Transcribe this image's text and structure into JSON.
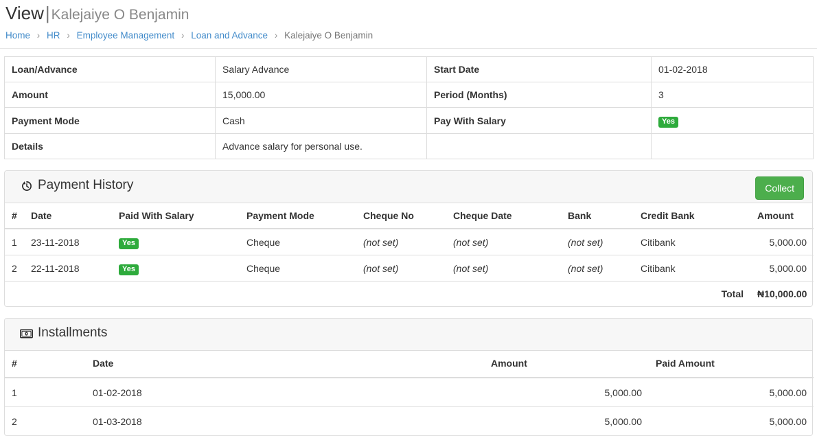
{
  "header": {
    "title_main": "View",
    "title_separator": "|",
    "subject": "Kalejaiye O Benjamin"
  },
  "breadcrumb": {
    "items": [
      {
        "label": "Home",
        "link": true
      },
      {
        "label": "HR",
        "link": true
      },
      {
        "label": "Employee Management",
        "link": true
      },
      {
        "label": "Loan and Advance",
        "link": true
      },
      {
        "label": "Kalejaiye O Benjamin",
        "link": false
      }
    ],
    "divider": "›"
  },
  "details": {
    "rows": [
      {
        "left_label": "Loan/Advance",
        "left_value": "Salary Advance",
        "right_label": "Start Date",
        "right_value": "01-02-2018",
        "right_is_badge": false
      },
      {
        "left_label": "Amount",
        "left_value": "15,000.00",
        "right_label": "Period (Months)",
        "right_value": "3",
        "right_is_badge": false
      },
      {
        "left_label": "Payment Mode",
        "left_value": "Cash",
        "right_label": "Pay With Salary",
        "right_value": "Yes",
        "right_is_badge": true
      },
      {
        "left_label": "Details",
        "left_value": "Advance salary for personal use.",
        "right_label": "",
        "right_value": "",
        "right_is_badge": false
      }
    ]
  },
  "payment_history": {
    "panel_title": "Payment History",
    "panel_icon": "history-icon",
    "collect_label": "Collect",
    "columns": [
      "#",
      "Date",
      "Paid With Salary",
      "Payment Mode",
      "Cheque No",
      "Cheque Date",
      "Bank",
      "Credit Bank",
      "Amount"
    ],
    "rows": [
      {
        "num": "1",
        "date": "23-11-2018",
        "paid_with_salary": "Yes",
        "payment_mode": "Cheque",
        "cheque_no": "(not set)",
        "cheque_date": "(not set)",
        "bank": "(not set)",
        "credit_bank": "Citibank",
        "amount": "5,000.00"
      },
      {
        "num": "2",
        "date": "22-11-2018",
        "paid_with_salary": "Yes",
        "payment_mode": "Cheque",
        "cheque_no": "(not set)",
        "cheque_date": "(not set)",
        "bank": "(not set)",
        "credit_bank": "Citibank",
        "amount": "5,000.00"
      }
    ],
    "total_label": "Total",
    "total_value": "₦10,000.00"
  },
  "installments": {
    "panel_title": "Installments",
    "panel_icon": "money-bill-icon",
    "columns": [
      "#",
      "Date",
      "Amount",
      "Paid Amount"
    ],
    "rows": [
      {
        "num": "1",
        "date": "01-02-2018",
        "amount": "5,000.00",
        "paid_amount": "5,000.00"
      },
      {
        "num": "2",
        "date": "01-03-2018",
        "amount": "5,000.00",
        "paid_amount": "5,000.00"
      }
    ]
  },
  "colors": {
    "link": "#428bca",
    "badge_green": "#2eab3c",
    "button_green": "#4cae4c",
    "not_set_red": "#c9565a",
    "panel_border": "#dddddd",
    "panel_heading_bg": "#f7f7f7"
  }
}
